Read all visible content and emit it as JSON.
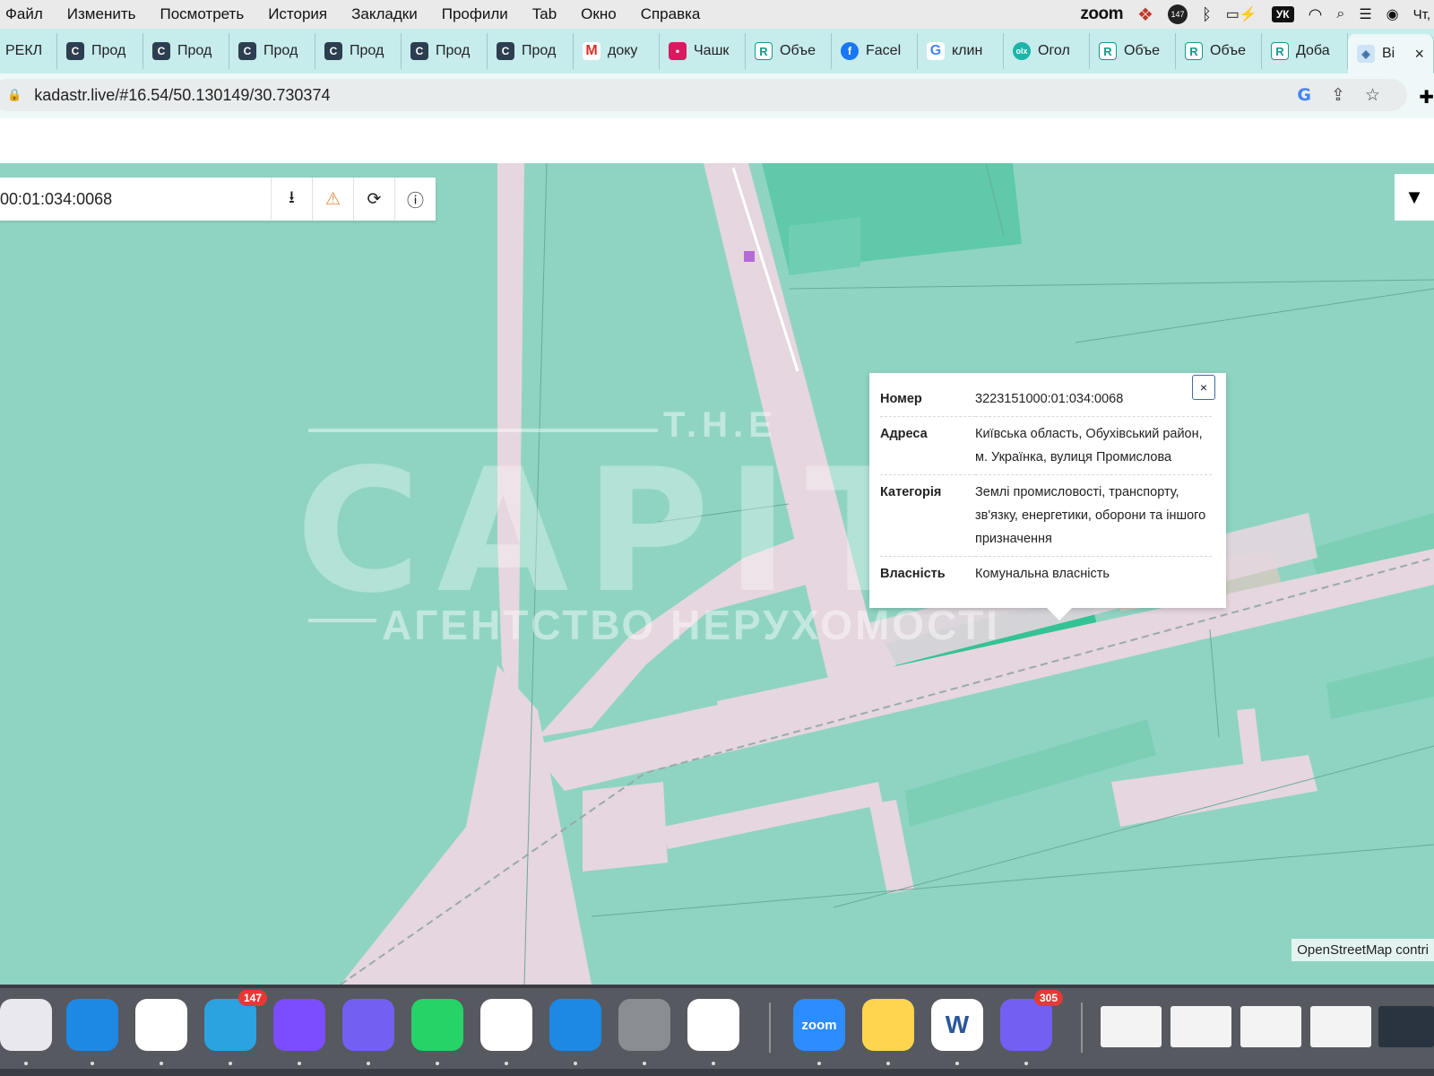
{
  "menubar": {
    "menus": [
      "Файл",
      "Изменить",
      "Посмотреть",
      "История",
      "Закладки",
      "Профили",
      "Tab",
      "Окно",
      "Справка"
    ],
    "zoom_label": "zoom",
    "lang": "УК",
    "clock": "Чт,"
  },
  "tabs": [
    {
      "label": "РЕКЛ",
      "icon": "none"
    },
    {
      "label": "Прод",
      "icon": "capital-icon"
    },
    {
      "label": "Прод",
      "icon": "capital-icon"
    },
    {
      "label": "Прод",
      "icon": "capital-icon"
    },
    {
      "label": "Прод",
      "icon": "capital-icon"
    },
    {
      "label": "Прод",
      "icon": "capital-icon"
    },
    {
      "label": "Прод",
      "icon": "capital-icon"
    },
    {
      "label": "доку",
      "icon": "gmail-icon"
    },
    {
      "label": "Чашк",
      "icon": "cat-icon"
    },
    {
      "label": "Объе",
      "icon": "r-icon"
    },
    {
      "label": "Facel",
      "icon": "facebook-icon"
    },
    {
      "label": "клин",
      "icon": "google-icon"
    },
    {
      "label": "Огол",
      "icon": "olx-icon"
    },
    {
      "label": "Объе",
      "icon": "r-icon"
    },
    {
      "label": "Объе",
      "icon": "r-icon"
    },
    {
      "label": "Доба",
      "icon": "r-icon"
    },
    {
      "label": "Ві",
      "icon": "kadastr-icon",
      "active": true
    }
  ],
  "address": {
    "url": "kadastr.live/#16.54/50.130149/30.730374"
  },
  "map": {
    "search_value": "00:01:034:0068",
    "attribution": "OpenStreetMap contri",
    "watermark": {
      "top": "T.H.E",
      "big": "CAPITAL",
      "sub": "АГЕНТСТВО НЕРУХОМОСТІ"
    }
  },
  "popup": {
    "rows": [
      {
        "key": "Номер",
        "value": "3223151000:01:034:0068"
      },
      {
        "key": "Адреса",
        "value": "Київська область, Обухівський район, м. Українка, вулиця Промислова"
      },
      {
        "key": "Категорія",
        "value": "Землі промисловості, транспорту, зв'язку, енергетики, оборони та іншого призначення"
      },
      {
        "key": "Власність",
        "value": "Комунальна власність"
      }
    ],
    "close_label": "×"
  },
  "dock": {
    "apps": [
      {
        "name": "launchpad-icon",
        "color": "#e8e8ee"
      },
      {
        "name": "safari-icon",
        "color": "#1e88e5"
      },
      {
        "name": "chrome-icon",
        "color": "#ffffff"
      },
      {
        "name": "telegram-icon",
        "color": "#2aa3e0",
        "badge": "147"
      },
      {
        "name": "messenger-icon",
        "color": "#7b4dff"
      },
      {
        "name": "viber-icon",
        "color": "#7360f2"
      },
      {
        "name": "whatsapp-icon",
        "color": "#25d366"
      },
      {
        "name": "photos-icon",
        "color": "#ffffff"
      },
      {
        "name": "app-store-icon",
        "color": "#1e88e5"
      },
      {
        "name": "system-preferences-icon",
        "color": "#8a8d91"
      },
      {
        "name": "freeform-icon",
        "color": "#ffffff"
      },
      {
        "name": "zoom-icon",
        "color": "#2d8cff"
      },
      {
        "name": "notes-icon",
        "color": "#ffd54f"
      },
      {
        "name": "word-icon",
        "color": "#ffffff"
      },
      {
        "name": "viber-icon",
        "color": "#7360f2",
        "badge": "305"
      }
    ],
    "zoom_label": "zoom",
    "word_label": "W"
  },
  "colors": {
    "land": "#8fd4c3",
    "road": "#e6d6df",
    "dark_parcel": "#3fc79f",
    "highlight_parcel": "#35c294"
  }
}
